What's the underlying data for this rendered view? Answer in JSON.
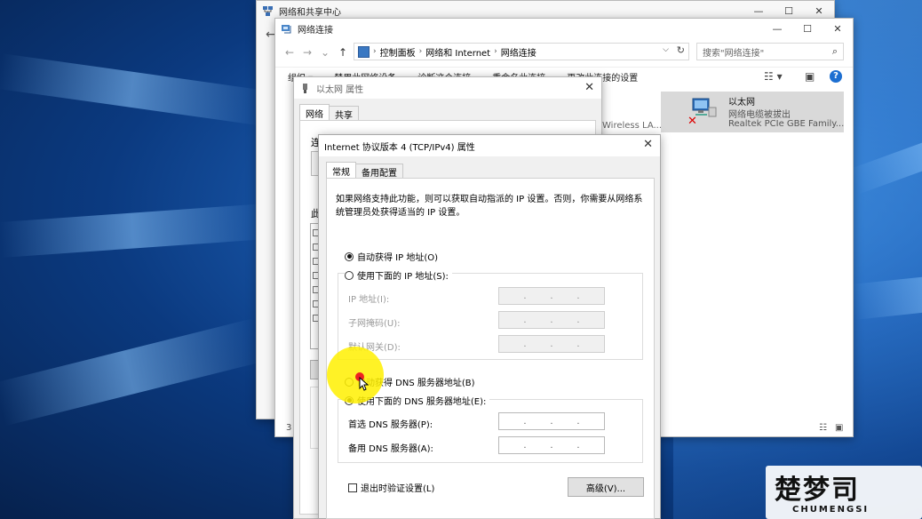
{
  "nsc_window": {
    "title": "网络和共享中心",
    "back_icon": "back-arrow-icon"
  },
  "nc_window": {
    "title": "网络连接",
    "address": {
      "crumbs": [
        "控制面板",
        "网络和 Internet",
        "网络连接"
      ]
    },
    "search": {
      "placeholder": "搜索\"网络连接\""
    },
    "commands": [
      "组织 ▾",
      "禁用此网络设备",
      "诊断这个连接",
      "重命名此连接",
      "更改此连接的设置"
    ],
    "connection": {
      "name": "以太网",
      "status": "网络电缆被拔出",
      "device": "Realtek PCIe GBE Family..."
    },
    "wireless_partial": "Wireless LA...",
    "item_count": "3"
  },
  "eth_window": {
    "title": "以太网 属性",
    "tabs": [
      "网络",
      "共享"
    ],
    "label_connect": "连",
    "label_this": "此"
  },
  "tcp_window": {
    "title": "Internet 协议版本 4 (TCP/IPv4) 属性",
    "tabs": [
      "常规",
      "备用配置"
    ],
    "description": "如果网络支持此功能，则可以获取自动指派的 IP 设置。否则，你需要从网络系统管理员处获得适当的 IP 设置。",
    "ip_auto": "自动获得 IP 地址(O)",
    "ip_manual": "使用下面的 IP 地址(S):",
    "ip_address_label": "IP 地址(I):",
    "subnet_label": "子网掩码(U):",
    "gateway_label": "默认网关(D):",
    "dns_auto": "自动获得 DNS 服务器地址(B)",
    "dns_manual": "使用下面的 DNS 服务器地址(E):",
    "dns_pref_label": "首选 DNS 服务器(P):",
    "dns_alt_label": "备用 DNS 服务器(A):",
    "validate_label": "退出时验证设置(L)",
    "advanced_button": "高级(V)...",
    "ip_mode": "auto",
    "dns_mode": "manual"
  },
  "watermark": {
    "big": "楚梦司",
    "small": "CHUMENGSI"
  }
}
